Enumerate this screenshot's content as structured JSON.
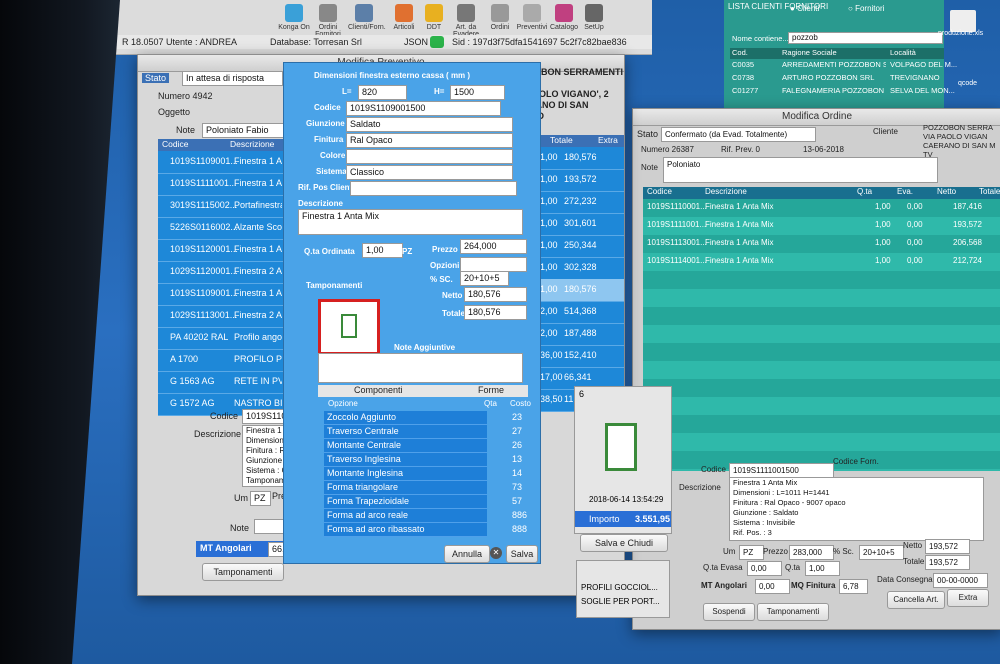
{
  "toolbar": {
    "items": [
      "Konga On",
      "Ordini Fornitori",
      "Clienti/Forn.",
      "Articoli",
      "DDT",
      "Art. da Evadere",
      "Ordini",
      "Preventivi",
      "Catalogo",
      "SetUp"
    ]
  },
  "status": {
    "version": "R 18.0507 Utente : ANDREA",
    "database": "Database: Torresan Srl",
    "json": "JSON",
    "sid": "Sid : 197d3f75dfa1541697 5c2f7c82bae836"
  },
  "clients": {
    "title": "LISTA CLIENTI FORNITORI",
    "radio1": "Clienti",
    "radio2": "Fornitori",
    "search_label": "Nome contiene...",
    "search_value": "pozzob",
    "headers": [
      "Cod.",
      "Ragione Sociale",
      "Località"
    ],
    "rows": [
      {
        "cod": "C0035",
        "name": "ARREDAMENTI POZZOBON S...",
        "loc": "VOLPAGO DEL M..."
      },
      {
        "cod": "C0738",
        "name": "ARTURO POZZOBON SRL",
        "loc": "TREVIGNANO"
      },
      {
        "cod": "C01277",
        "name": "FALEGNAMERIA POZZOBON E...",
        "loc": "SELVA DEL MON..."
      }
    ],
    "file": "produzione.xls",
    "file2": "qcode"
  },
  "preventivo": {
    "title": "Modifica Preventivo",
    "stato_label": "Stato",
    "stato_value": "In attesa di risposta",
    "numero": "Numero 4942",
    "oggetto_label": "Oggetto",
    "note_label": "Note",
    "note_value": "Poloniato Fabio",
    "cliente": [
      "POZZOBON SERRAMENTI",
      "SRL",
      "VIA PAOLO VIGANO', 2",
      "CAERANO DI SAN MARCO"
    ],
    "headers": [
      "Codice",
      "Descrizione",
      "Totale",
      "Extra"
    ],
    "rows": [
      {
        "code": "1019S1109001...",
        "desc": "Finestra 1 Anta",
        "qty": "1,00",
        "tot": "180,576"
      },
      {
        "code": "1019S1111001...",
        "desc": "Finestra 1 Anta",
        "qty": "1,00",
        "tot": "193,572"
      },
      {
        "code": "3019S1115002...",
        "desc": "Portafinestra co",
        "qty": "1,00",
        "tot": "272,232"
      },
      {
        "code": "5226S0116002...",
        "desc": "Alzante Scorrev",
        "qty": "1,00",
        "tot": "301,601"
      },
      {
        "code": "1019S1120001...",
        "desc": "Finestra 1 Anta",
        "qty": "1,00",
        "tot": "250,344"
      },
      {
        "code": "1029S1120001...",
        "desc": "Finestra 2 Ante",
        "qty": "1,00",
        "tot": "302,328"
      },
      {
        "code": "1019S1109001...",
        "desc": "Finestra 1 Anta",
        "qty": "1,00",
        "tot": "180,576"
      },
      {
        "code": "1029S1113001...",
        "desc": "Finestra 2 Ante",
        "qty": "2,00",
        "tot": "514,368"
      },
      {
        "code": "PA 40202 RAL",
        "desc": "Profilo angolare",
        "qty": "2,00",
        "tot": "187,488"
      },
      {
        "code": "A 1700",
        "desc": "PROFILO PER I",
        "qty": "36,00",
        "tot": "152,410"
      },
      {
        "code": "G 1563 AG",
        "desc": "RETE IN PVC B",
        "qty": "17,00",
        "tot": "66,341"
      },
      {
        "code": "G 1572 AG",
        "desc": "NASTRO BIADE",
        "qty": "38,50",
        "tot": "11,365"
      }
    ],
    "codice_label": "Codice",
    "codice_value": "1019S110900150",
    "descrizione_label": "Descrizione",
    "desc_lines": [
      "Finestra 1 Anta M",
      "Dimensioni : L=82",
      "Finitura : Ral Op",
      "Giunzione : Saldat",
      "Sistema : Classic",
      "Tamponamenti : 0"
    ],
    "um_label": "Um",
    "um_value": "PZ",
    "prezzo_label": "Prezzo",
    "note2_label": "Note",
    "mt_angolari_label": "MT Angolari",
    "mt_angolari_value": "66,00",
    "mq_label": "MQ Fini",
    "tamponamenti_btn": "Tamponamenti",
    "side_values": [
      "0,576",
      "0,576"
    ]
  },
  "dialog": {
    "dim_title": "Dimensioni finestra esterno cassa ( mm )",
    "l_label": "L=",
    "l_value": "820",
    "h_label": "H=",
    "h_value": "1500",
    "codice_label": "Codice",
    "codice_value": "1019S1109001500",
    "giunzione_label": "Giunzione",
    "giunzione_value": "Saldato",
    "finitura_label": "Finitura",
    "finitura_value": "Ral Opaco",
    "colore_label": "Colore",
    "sistema_label": "Sistema",
    "sistema_value": "Classico",
    "rif_label": "Rif. Pos Cliente",
    "descrizione_label": "Descrizione",
    "descrizione_value": "Finestra 1 Anta Mix",
    "qta_label": "Q.ta Ordinata",
    "qta_value": "1,00",
    "qta_unit": "PZ",
    "prezzo_label": "Prezzo",
    "prezzo_value": "264,000",
    "opzioni_label": "Opzioni",
    "sc_label": "% SC.",
    "sc_value": "20+10+5",
    "netto_label": "Netto",
    "netto_value": "180,576",
    "totale_label": "Totale",
    "totale_value": "180,576",
    "tamponamenti_label": "Tamponamenti",
    "note_label": "Note Aggiuntive",
    "tab_componenti": "Componenti",
    "tab_forme": "Forme",
    "col_opzione": "Opzione",
    "col_qta": "Qta",
    "col_costo": "Costo",
    "components": [
      {
        "name": "Zoccolo Aggiunto",
        "cost": "23"
      },
      {
        "name": "Traverso Centrale",
        "cost": "27"
      },
      {
        "name": "Montante Centrale",
        "cost": "26"
      },
      {
        "name": "Traverso Inglesina",
        "cost": "13"
      },
      {
        "name": "Montante Inglesina",
        "cost": "14"
      },
      {
        "name": "Forma triangolare",
        "cost": "73"
      },
      {
        "name": "Forma Trapezioidale",
        "cost": "57"
      },
      {
        "name": "Forma ad arco reale",
        "cost": "886"
      },
      {
        "name": "Forma ad arco ribassato",
        "cost": "888"
      }
    ],
    "annulla": "Annulla",
    "salva": "Salva",
    "salva_chiudi": "Salva e Chiudi",
    "timestamp": "2018-06-14 13:54:29",
    "importo_label": "Importo",
    "importo_value": "3.551,95",
    "side_num": "6"
  },
  "ordine": {
    "title": "Modifica Ordine",
    "stato_label": "Stato",
    "stato_value": "Confermato (da Evad. Totalmente)",
    "numero": "Numero 26387",
    "rif": "Rif. Prev. 0",
    "date": "13-06-2018",
    "cliente_label": "Cliente",
    "cliente": [
      "POZZOBON SERRA",
      "VIA PAOLO VIGAN",
      "CAERANO DI SAN M",
      "TV"
    ],
    "note_label": "Note",
    "note_value": "Poloniato",
    "headers": [
      "Codice",
      "Descrizione",
      "Q.ta",
      "Eva.",
      "Netto",
      "Totale"
    ],
    "rows": [
      {
        "code": "1019S1110001...",
        "desc": "Finestra 1 Anta Mix",
        "qta": "1,00",
        "eva": "0,00",
        "netto": "187,416"
      },
      {
        "code": "1019S1111001...",
        "desc": "Finestra 1 Anta Mix",
        "qta": "1,00",
        "eva": "0,00",
        "netto": "193,572"
      },
      {
        "code": "1019S1113001...",
        "desc": "Finestra 1 Anta Mix",
        "qta": "1,00",
        "eva": "0,00",
        "netto": "206,568"
      },
      {
        "code": "1019S1114001...",
        "desc": "Finestra 1 Anta Mix",
        "qta": "1,00",
        "eva": "0,00",
        "netto": "212,724"
      }
    ],
    "codice_label": "Codice",
    "codice_value": "1019S1111001500",
    "codice_forn_label": "Codice Forn.",
    "descrizione_label": "Descrizione",
    "desc_lines": [
      "Finestra 1 Anta Mix",
      "Dimensioni : L=1011 H=1441",
      "Finitura : Ral Opaco - 9007 opaco",
      "Giunzione : Saldato",
      "Sistema : Invisibile",
      "Rif. Pos. : 3"
    ],
    "um_label": "Um",
    "um_value": "PZ",
    "prezzo_label": "Prezzo",
    "prezzo_value": "283,000",
    "sc_label": "% Sc.",
    "sc_value": "20+10+5",
    "netto_label": "Netto",
    "netto_value": "193,572",
    "qta_evasa_label": "Q.ta Evasa",
    "qta_evasa_value": "0,00",
    "qta_label": "Q.ta",
    "qta_value": "1,00",
    "totale_label": "Totale",
    "totale_value": "193,572",
    "mt_label": "MT Angolari",
    "mt_value": "0,00",
    "mq_label": "MQ Finitura",
    "mq_value": "6,78",
    "data_label": "Data Consegna",
    "data_value": "00-00-0000",
    "cancella": "Cancella Art.",
    "extra": "Extra",
    "sospendi": "Sospendi",
    "tamponamenti": "Tamponamenti"
  },
  "side_list": [
    "PROFILI GOCCIOL...",
    "SOGLIE PER PORT..."
  ]
}
